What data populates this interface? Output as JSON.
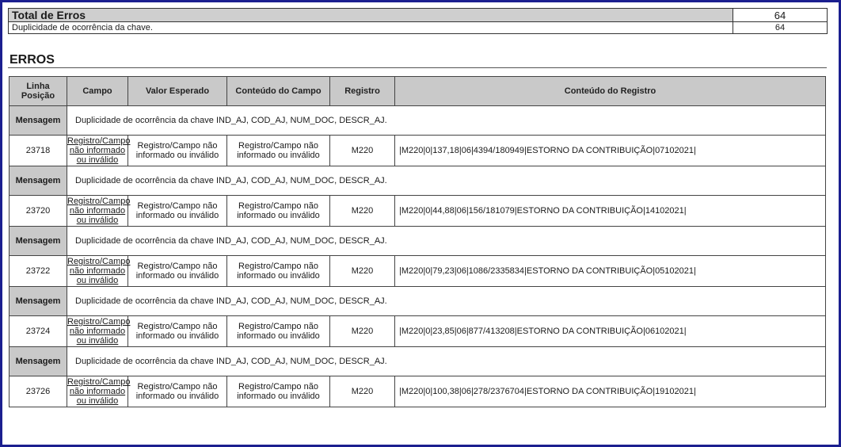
{
  "total": {
    "title": "Total de Erros",
    "total_count": "64",
    "description": "Duplicidade de ocorrência da chave.",
    "description_count": "64"
  },
  "section_title": "ERROS",
  "columns": {
    "linha": "Linha Posição",
    "campo": "Campo",
    "valor_esperado": "Valor Esperado",
    "conteudo_campo": "Conteúdo do Campo",
    "registro": "Registro",
    "conteudo_registro": "Conteúdo do Registro"
  },
  "errors": [
    {
      "msg_label": "Mensagem",
      "message": "Duplicidade de ocorrência da chave IND_AJ, COD_AJ, NUM_DOC, DESCR_AJ.",
      "linha": "23718",
      "campo": "Registro/Campo não informado ou inválido",
      "valor_esperado": "Registro/Campo não informado ou inválido",
      "conteudo_campo": "Registro/Campo não informado ou inválido",
      "registro": "M220",
      "conteudo_registro": "|M220|0|137,18|06|4394/180949|ESTORNO DA CONTRIBUIÇÃO|07102021|"
    },
    {
      "msg_label": "Mensagem",
      "message": "Duplicidade de ocorrência da chave IND_AJ, COD_AJ, NUM_DOC, DESCR_AJ.",
      "linha": "23720",
      "campo": "Registro/Campo não informado ou inválido",
      "valor_esperado": "Registro/Campo não informado ou inválido",
      "conteudo_campo": "Registro/Campo não informado ou inválido",
      "registro": "M220",
      "conteudo_registro": "|M220|0|44,88|06|156/181079|ESTORNO DA CONTRIBUIÇÃO|14102021|"
    },
    {
      "msg_label": "Mensagem",
      "message": "Duplicidade de ocorrência da chave IND_AJ, COD_AJ, NUM_DOC, DESCR_AJ.",
      "linha": "23722",
      "campo": "Registro/Campo não informado ou inválido",
      "valor_esperado": "Registro/Campo não informado ou inválido",
      "conteudo_campo": "Registro/Campo não informado ou inválido",
      "registro": "M220",
      "conteudo_registro": "|M220|0|79,23|06|1086/2335834|ESTORNO DA CONTRIBUIÇÃO|05102021|"
    },
    {
      "msg_label": "Mensagem",
      "message": "Duplicidade de ocorrência da chave IND_AJ, COD_AJ, NUM_DOC, DESCR_AJ.",
      "linha": "23724",
      "campo": "Registro/Campo não informado ou inválido",
      "valor_esperado": "Registro/Campo não informado ou inválido",
      "conteudo_campo": "Registro/Campo não informado ou inválido",
      "registro": "M220",
      "conteudo_registro": "|M220|0|23,85|06|877/413208|ESTORNO DA CONTRIBUIÇÃO|06102021|"
    },
    {
      "msg_label": "Mensagem",
      "message": "Duplicidade de ocorrência da chave IND_AJ, COD_AJ, NUM_DOC, DESCR_AJ.",
      "linha": "23726",
      "campo": "Registro/Campo não informado ou inválido",
      "valor_esperado": "Registro/Campo não informado ou inválido",
      "conteudo_campo": "Registro/Campo não informado ou inválido",
      "registro": "M220",
      "conteudo_registro": "|M220|0|100,38|06|278/2376704|ESTORNO DA CONTRIBUIÇÃO|19102021|"
    }
  ]
}
